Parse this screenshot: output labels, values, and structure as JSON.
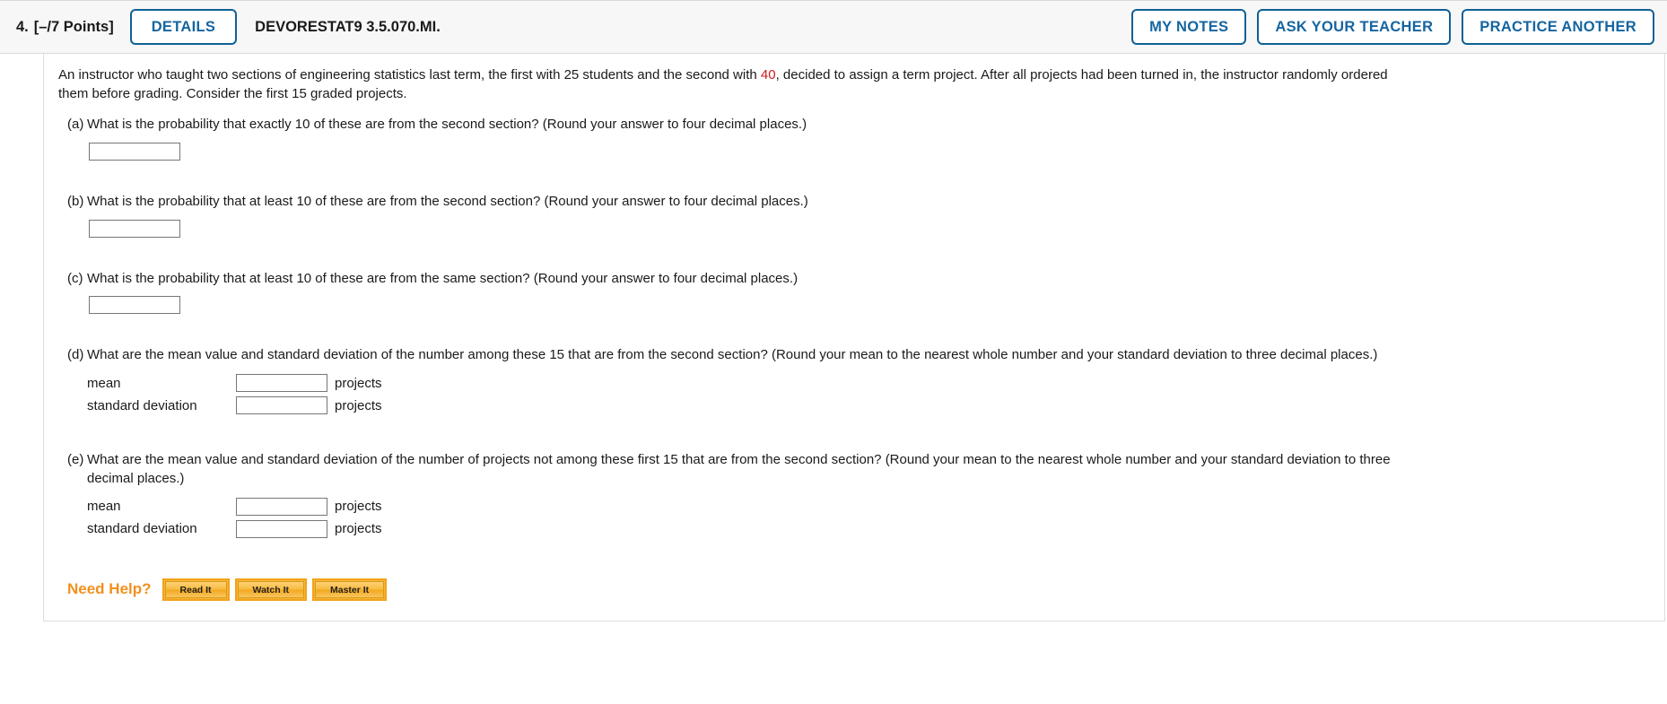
{
  "header": {
    "question_number": "4.",
    "points": "[–/7 Points]",
    "details_label": "DETAILS",
    "question_code": "DEVORESTAT9 3.5.070.MI.",
    "my_notes_label": "MY NOTES",
    "ask_teacher_label": "ASK YOUR TEACHER",
    "practice_another_label": "PRACTICE ANOTHER",
    "accent_color": "#0f6193"
  },
  "stem": {
    "text_before_highlight": "An instructor who taught two sections of engineering statistics last term, the first with 25 students and the second with ",
    "highlight_value": "40",
    "highlight_color": "#d01b1b",
    "text_after_highlight": ", decided to assign a term project. After all projects had been turned in, the instructor randomly ordered them before grading. Consider the first 15 graded projects."
  },
  "parts": [
    {
      "label": "(a)",
      "text": "What is the probability that exactly 10 of these are from the second section? (Round your answer to four decimal places.)",
      "answer_value": "",
      "answer_placeholder": ""
    },
    {
      "label": "(b)",
      "text": "What is the probability that at least 10 of these are from the second section? (Round your answer to four decimal places.)",
      "answer_value": "",
      "answer_placeholder": ""
    },
    {
      "label": "(c)",
      "text": "What is the probability that at least 10 of these are from the same section? (Round your answer to four decimal places.)",
      "answer_value": "",
      "answer_placeholder": ""
    },
    {
      "label": "(d)",
      "text": "What are the mean value and standard deviation of the number among these 15 that are from the second section? (Round your mean to the nearest whole number and your standard deviation to three decimal places.)",
      "rows": [
        {
          "name": "mean",
          "value": "",
          "unit": "projects"
        },
        {
          "name": "standard deviation",
          "value": "",
          "unit": "projects"
        }
      ]
    },
    {
      "label": "(e)",
      "text": "What are the mean value and standard deviation of the number of projects not among these first 15 that are from the second section? (Round your mean to the nearest whole number and your standard deviation to three decimal places.)",
      "rows": [
        {
          "name": "mean",
          "value": "",
          "unit": "projects"
        },
        {
          "name": "standard deviation",
          "value": "",
          "unit": "projects"
        }
      ]
    }
  ],
  "need_help": {
    "label": "Need Help?",
    "label_color": "#f0901e",
    "buttons": [
      {
        "label": "Read It"
      },
      {
        "label": "Watch It"
      },
      {
        "label": "Master It"
      }
    ]
  }
}
